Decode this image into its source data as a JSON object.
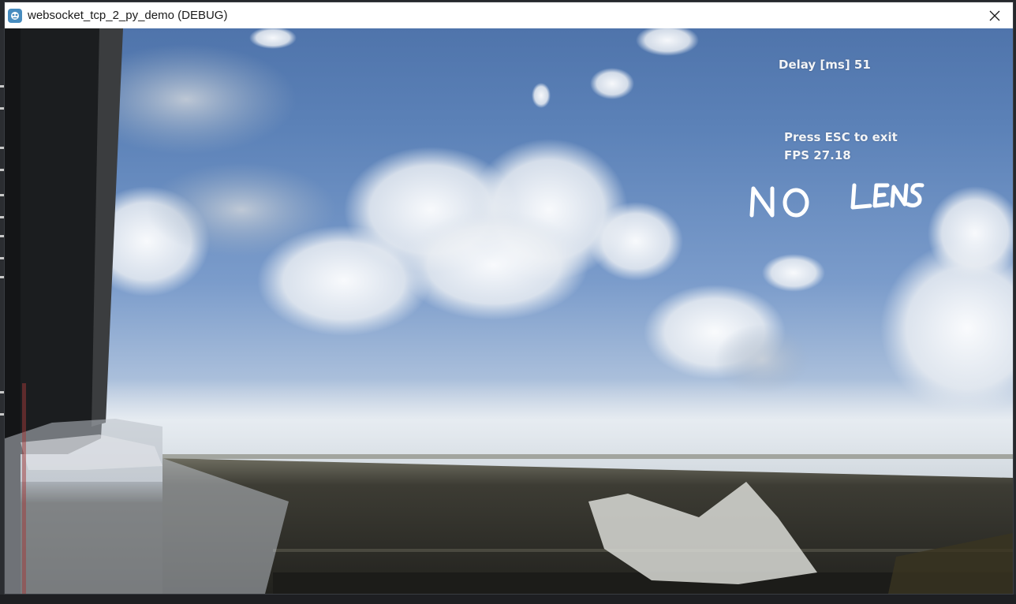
{
  "window": {
    "title": "websocket_tcp_2_py_demo (DEBUG)",
    "app_icon": "godot-icon",
    "close_icon": "close-icon"
  },
  "overlay": {
    "delay_label": "Delay [ms] 51",
    "exit_hint": "Press ESC to exit",
    "fps_label": "FPS 27.18"
  },
  "annotation": {
    "handwritten_text": "NO LENS"
  },
  "colors": {
    "overlay_text": "#f2f4f7",
    "titlebar": "#ffffff",
    "sky": "#5c82b8"
  }
}
